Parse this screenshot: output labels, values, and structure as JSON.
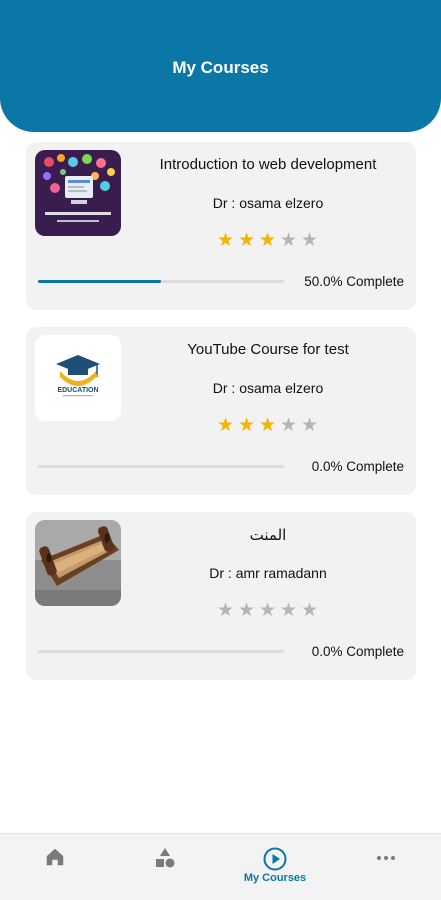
{
  "header": {
    "title": "My Courses"
  },
  "courses": [
    {
      "title": "Introduction to web development",
      "instructor": "Dr : osama elzero",
      "rating": 3,
      "max_rating": 5,
      "progress": 0.5,
      "progress_label": "50.0% Complete",
      "thumbnail": "web-development-thumbnail"
    },
    {
      "title": "YouTube Course for test",
      "instructor": "Dr : osama elzero",
      "rating": 3,
      "max_rating": 5,
      "progress": 0.0,
      "progress_label": "0.0% Complete",
      "thumbnail": "education-logo-thumbnail",
      "thumbnail_text": "EDUCATION"
    },
    {
      "title": "المنت",
      "instructor": "Dr : amr ramadann",
      "rating": 0,
      "max_rating": 5,
      "progress": 0.0,
      "progress_label": "0.0% Complete",
      "thumbnail": "wooden-tray-thumbnail"
    }
  ],
  "bottom_nav": {
    "items": [
      {
        "icon": "home-icon",
        "label": ""
      },
      {
        "icon": "categories-icon",
        "label": ""
      },
      {
        "icon": "play-circle-icon",
        "label": "My Courses",
        "active": true
      },
      {
        "icon": "more-icon",
        "label": ""
      }
    ]
  },
  "colors": {
    "primary": "#0a77a6",
    "star_filled": "#f4b400",
    "star_empty": "#b5b5b5",
    "card_bg": "#f2f2f2",
    "nav_inactive": "#7a7a7a"
  }
}
